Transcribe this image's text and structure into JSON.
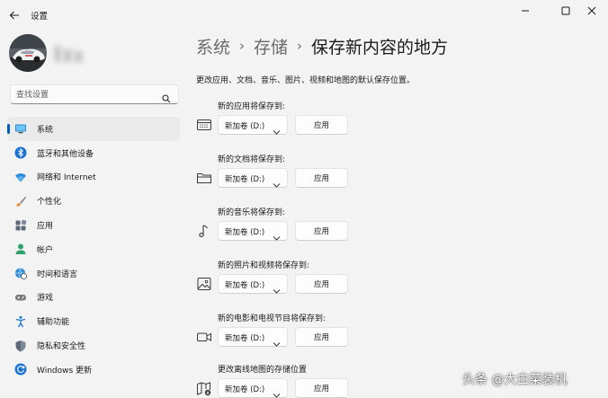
{
  "window": {
    "title": "设置",
    "controls": [
      "minimize-icon",
      "maximize-icon",
      "close-icon"
    ]
  },
  "user": {
    "avatar": "avatar-image",
    "name_hidden": true
  },
  "search": {
    "placeholder": "查找设置",
    "icon": "search-icon"
  },
  "nav": {
    "items": [
      {
        "label": "系统",
        "icon": "display-icon",
        "active": true
      },
      {
        "label": "蓝牙和其他设备",
        "icon": "bluetooth-icon",
        "active": false
      },
      {
        "label": "网络和 Internet",
        "icon": "wifi-icon",
        "active": false
      },
      {
        "label": "个性化",
        "icon": "brush-icon",
        "active": false
      },
      {
        "label": "应用",
        "icon": "apps-icon",
        "active": false
      },
      {
        "label": "帐户",
        "icon": "account-icon",
        "active": false
      },
      {
        "label": "时间和语言",
        "icon": "globe-clock-icon",
        "active": false
      },
      {
        "label": "游戏",
        "icon": "gamepad-icon",
        "active": false
      },
      {
        "label": "辅助功能",
        "icon": "accessibility-icon",
        "active": false
      },
      {
        "label": "隐私和安全性",
        "icon": "shield-icon",
        "active": false
      },
      {
        "label": "Windows 更新",
        "icon": "update-icon",
        "active": false
      }
    ]
  },
  "breadcrumb": {
    "items": [
      "系统",
      "存储"
    ],
    "separator": "›",
    "current": "保存新内容的地方"
  },
  "description": "更改应用、文档、音乐、图片、视频和地图的默认保存位置。",
  "save_rows": [
    {
      "label": "新的应用将保存到:",
      "icon": "app-window-icon",
      "value": "新加卷 (D:)",
      "apply": "应用"
    },
    {
      "label": "新的文档将保存到:",
      "icon": "folder-icon",
      "value": "新加卷 (D:)",
      "apply": "应用"
    },
    {
      "label": "新的音乐将保存到:",
      "icon": "music-note-icon",
      "value": "新加卷 (D:)",
      "apply": "应用"
    },
    {
      "label": "新的照片和视频将保存到:",
      "icon": "photo-icon",
      "value": "新加卷 (D:)",
      "apply": "应用"
    },
    {
      "label": "新的电影和电视节目将保存到:",
      "icon": "video-camera-icon",
      "value": "新加卷 (D:)",
      "apply": "应用"
    },
    {
      "label": "更改离线地图的存储位置",
      "icon": "map-download-icon",
      "value": "新加卷 (D:)",
      "apply": "应用"
    }
  ],
  "watermark": "头条 @大白菜装机",
  "colors": {
    "accent": "#005fb8",
    "background": "#f3f3f3",
    "nav_active": "#eaeaea"
  }
}
